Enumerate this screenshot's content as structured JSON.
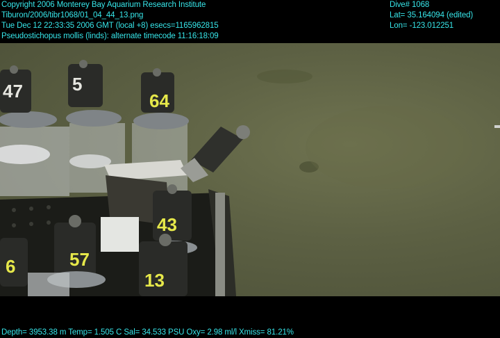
{
  "header_left": {
    "copyright": "Copyright 2006 Monterey Bay Aquarium Research Institute",
    "filename": "Tiburon/2006/tibr1068/01_04_44_13.png",
    "datetime": "Tue Dec 12 22:33:35 2006 GMT (local +8)  esecs=1165962815",
    "species_line": "Pseudostichopus mollis (linds): alternate timecode 11:16:18:09"
  },
  "header_right": {
    "dive": "Dive# 1068",
    "lat": "Lat= 35.164094 (edited)",
    "lon": "Lon= -123.012251"
  },
  "footer": {
    "telemetry": "Depth= 3953.38 m  Temp= 1.505 C  Sal= 34.533 PSU  Oxy= 2.98 ml/l  Xmiss= 81.21%"
  },
  "scene": {
    "description_items": [
      "sediment-core-tubes",
      "core-rack",
      "seafloor"
    ],
    "core_labels": [
      "47",
      "5",
      "64",
      "43",
      "6",
      "57",
      "13"
    ],
    "colors": {
      "overlay_text": "#37e6ea",
      "seafloor": "#5c6043",
      "label_yellow": "#e6e84a"
    }
  }
}
